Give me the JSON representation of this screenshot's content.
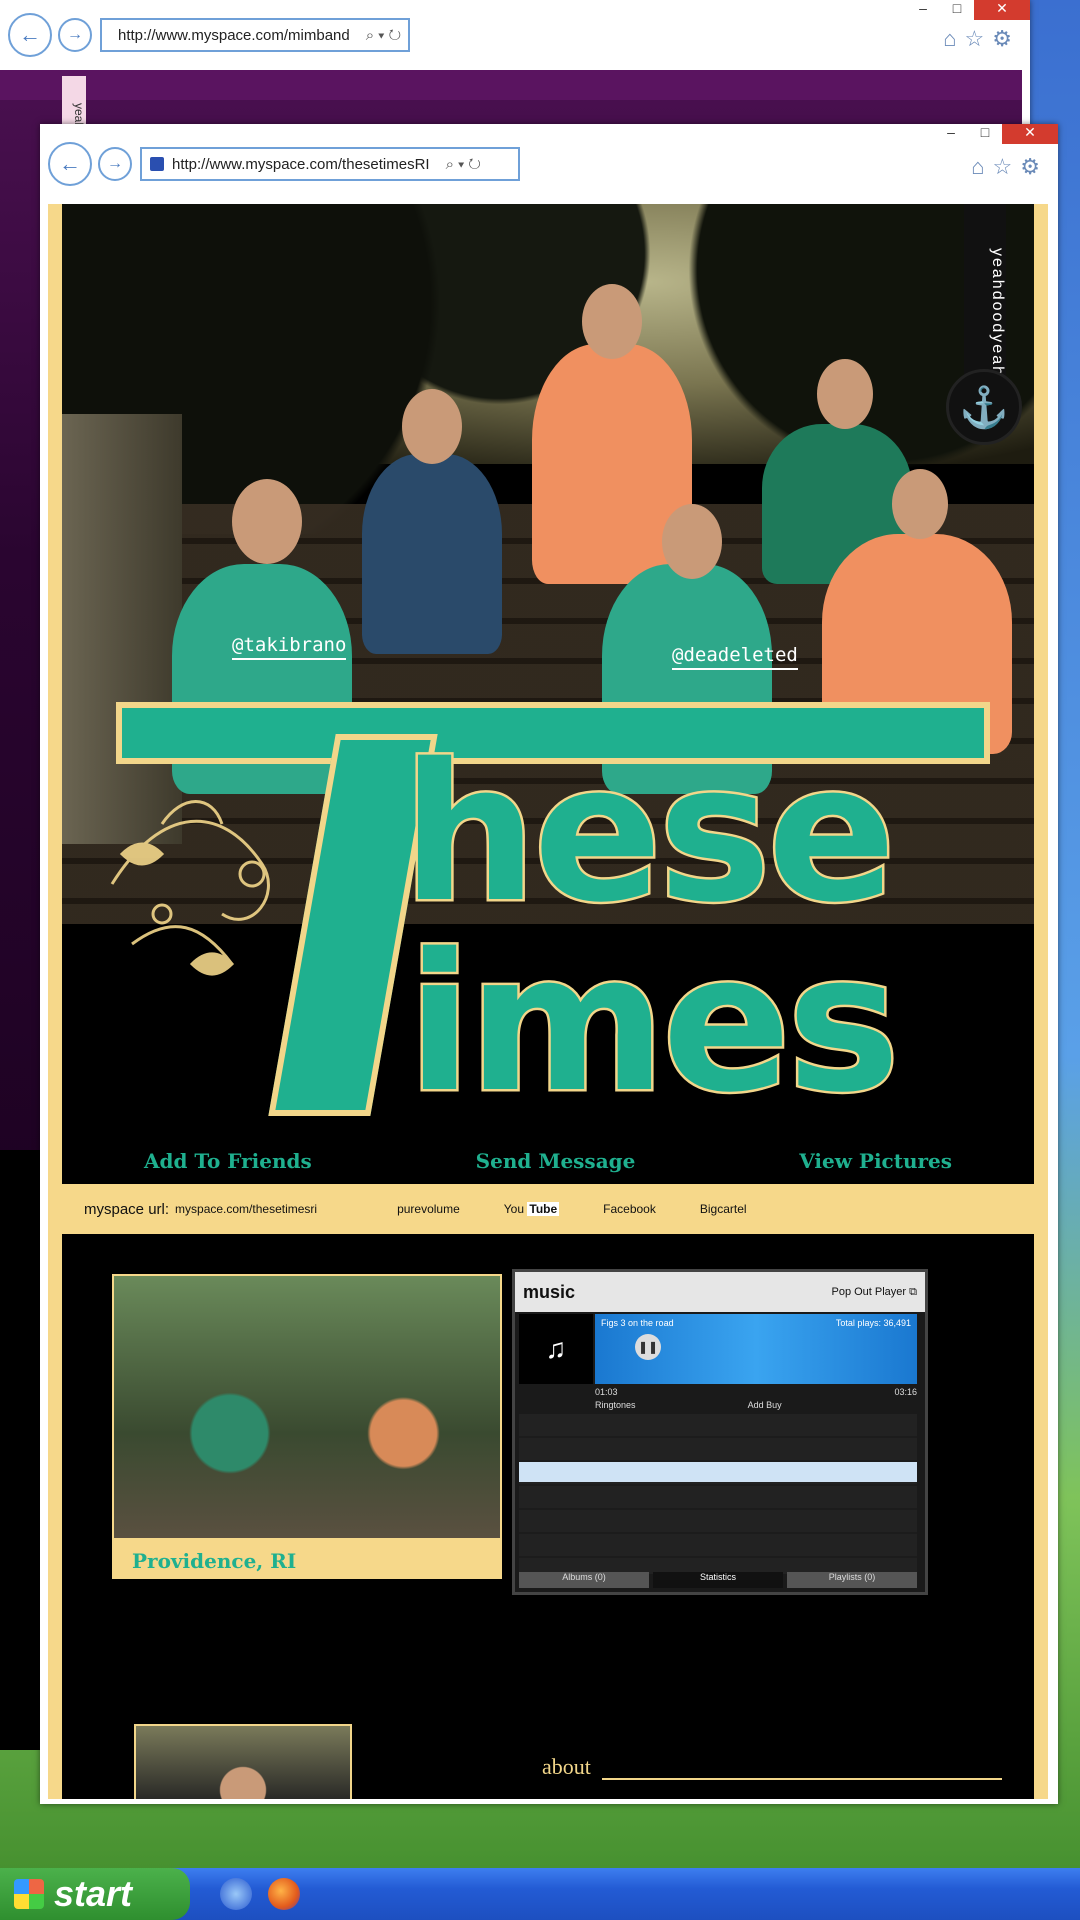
{
  "back_window": {
    "url": "http://www.myspace.com/mimband",
    "side_text": "yeah"
  },
  "front_window": {
    "url": "http://www.myspace.com/thesetimesRI",
    "controls": {
      "minimize": "–",
      "maximize": "□",
      "close": "✕"
    }
  },
  "hero": {
    "brand_vertical": "yeahdoodyeah",
    "handles": [
      "@takibrano",
      "@deadeleted"
    ],
    "logo_line1": "hese",
    "logo_line2": "imes",
    "actions": [
      "Add To Friends",
      "Send Message",
      "View  Pictures"
    ]
  },
  "linkbar": {
    "label": "myspace url:",
    "url": "myspace.com/thesetimesri",
    "links": {
      "purevolume": "purevolume",
      "youtube_a": "You",
      "youtube_b": "Tube",
      "facebook": "Facebook",
      "bigcartel": "Bigcartel"
    }
  },
  "photo": {
    "caption": "Providence, RI"
  },
  "player": {
    "brand": "music",
    "popout": "Pop Out Player",
    "total_plays_label": "Total plays:",
    "total_plays": "36,491",
    "track": "Figs",
    "artist": "3 on the road",
    "time_current": "01:03",
    "time_total": "03:16",
    "ringtones": "Ringtones",
    "add": "Add",
    "buy": "Buy",
    "tabs": [
      "Albums (0)",
      "Statistics",
      "Playlists (0)"
    ]
  },
  "about": {
    "heading": "about"
  },
  "taskbar": {
    "start": "start"
  },
  "colors": {
    "teal": "#1fb08f",
    "cream": "#f6d88a",
    "close_red": "#d33b2e"
  }
}
